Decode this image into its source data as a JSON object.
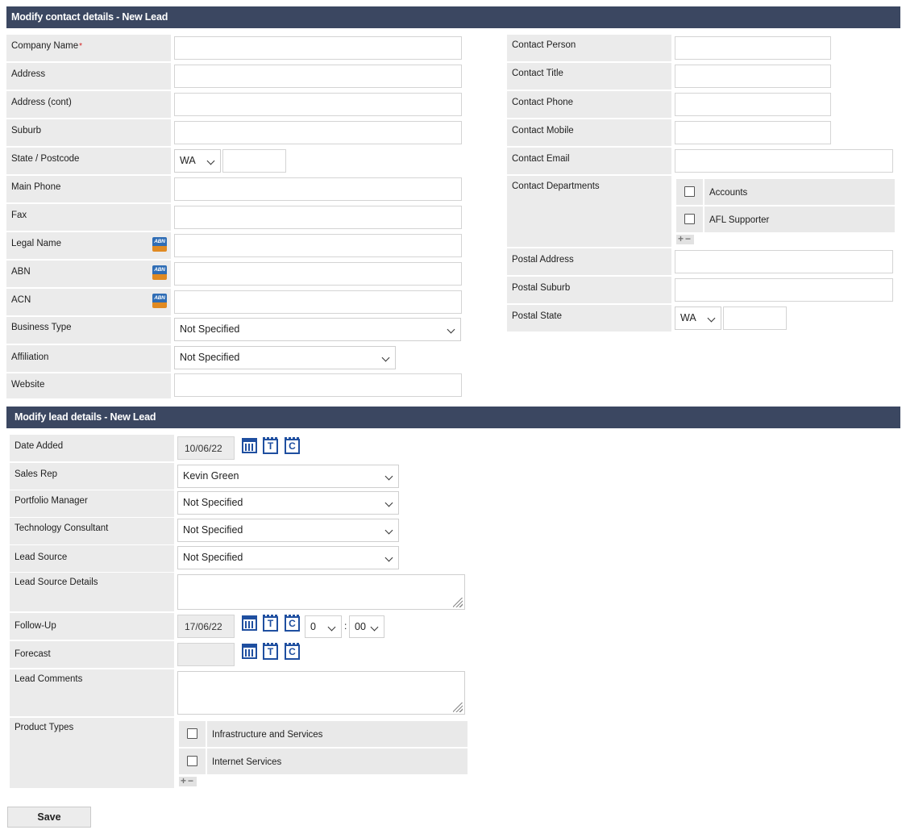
{
  "contact_section": {
    "title": "Modify contact details - New Lead",
    "labels": {
      "company_name": "Company Name",
      "required_mark": "*",
      "address": "Address",
      "address_cont": "Address (cont)",
      "suburb": "Suburb",
      "state_postcode": "State / Postcode",
      "main_phone": "Main Phone",
      "fax": "Fax",
      "legal_name": "Legal Name",
      "abn": "ABN",
      "acn": "ACN",
      "business_type": "Business Type",
      "affiliation": "Affiliation",
      "website": "Website",
      "contact_person": "Contact Person",
      "contact_title": "Contact Title",
      "contact_phone": "Contact Phone",
      "contact_mobile": "Contact Mobile",
      "contact_email": "Contact Email",
      "contact_departments": "Contact Departments",
      "postal_address": "Postal Address",
      "postal_suburb": "Postal Suburb",
      "postal_state": "Postal State"
    },
    "values": {
      "state": "WA",
      "business_type": "Not Specified",
      "affiliation": "Not Specified",
      "postal_state": "WA"
    },
    "abn_icon_text": "ABN",
    "departments": [
      {
        "label": "Accounts",
        "checked": false
      },
      {
        "label": "AFL Supporter",
        "checked": false
      }
    ]
  },
  "lead_section": {
    "title": "Modify lead details - New Lead",
    "labels": {
      "date_added": "Date Added",
      "sales_rep": "Sales Rep",
      "portfolio_manager": "Portfolio Manager",
      "technology_consultant": "Technology Consultant",
      "lead_source": "Lead Source",
      "lead_source_details": "Lead Source Details",
      "follow_up": "Follow-Up",
      "forecast": "Forecast",
      "lead_comments": "Lead Comments",
      "product_types": "Product Types"
    },
    "values": {
      "date_added": "10/06/22",
      "sales_rep": "Kevin Green",
      "portfolio_manager": "Not Specified",
      "technology_consultant": "Not Specified",
      "lead_source": "Not Specified",
      "follow_up_date": "17/06/22",
      "follow_up_hour": "0",
      "follow_up_minute": "00",
      "forecast": ""
    },
    "time_separator": ":",
    "product_types": [
      {
        "label": "Infrastructure and Services",
        "checked": false
      },
      {
        "label": "Internet Services",
        "checked": false
      }
    ]
  },
  "icons": {
    "calendar": "calendar-icon",
    "today": "T",
    "clear": "C",
    "add_remove": "+−"
  },
  "actions": {
    "save_label": "Save"
  }
}
